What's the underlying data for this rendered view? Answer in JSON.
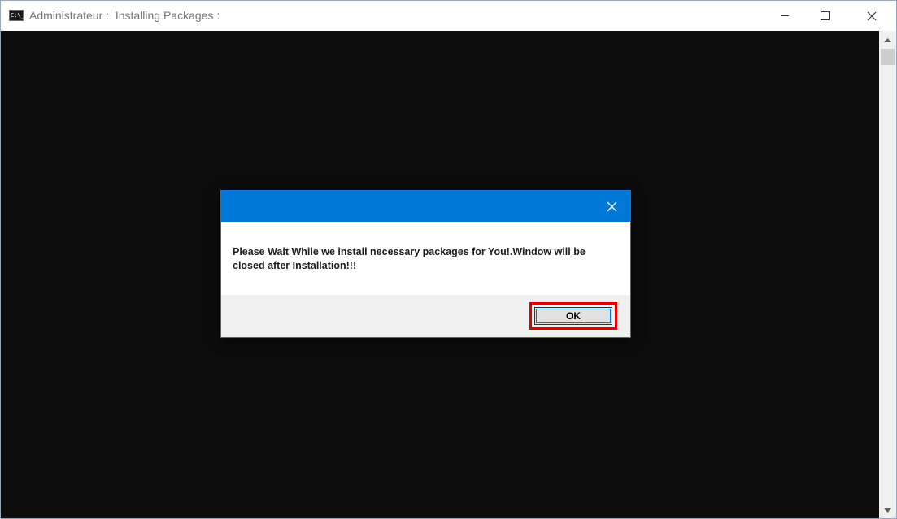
{
  "window": {
    "title": "Administrateur :  Installing Packages :",
    "icon": "cmd-icon",
    "icon_text": "C:\\_",
    "controls": {
      "minimize": "minimize-icon",
      "maximize": "maximize-icon",
      "close": "close-icon"
    }
  },
  "dialog": {
    "message": "Please Wait While we install necessary packages for You!.Window will be closed after Installation!!!",
    "ok_label": "OK",
    "close": "close-icon"
  },
  "colors": {
    "console_bg": "#0c0c0c",
    "dialog_titlebar": "#0078d7",
    "highlight": "#e00000"
  }
}
